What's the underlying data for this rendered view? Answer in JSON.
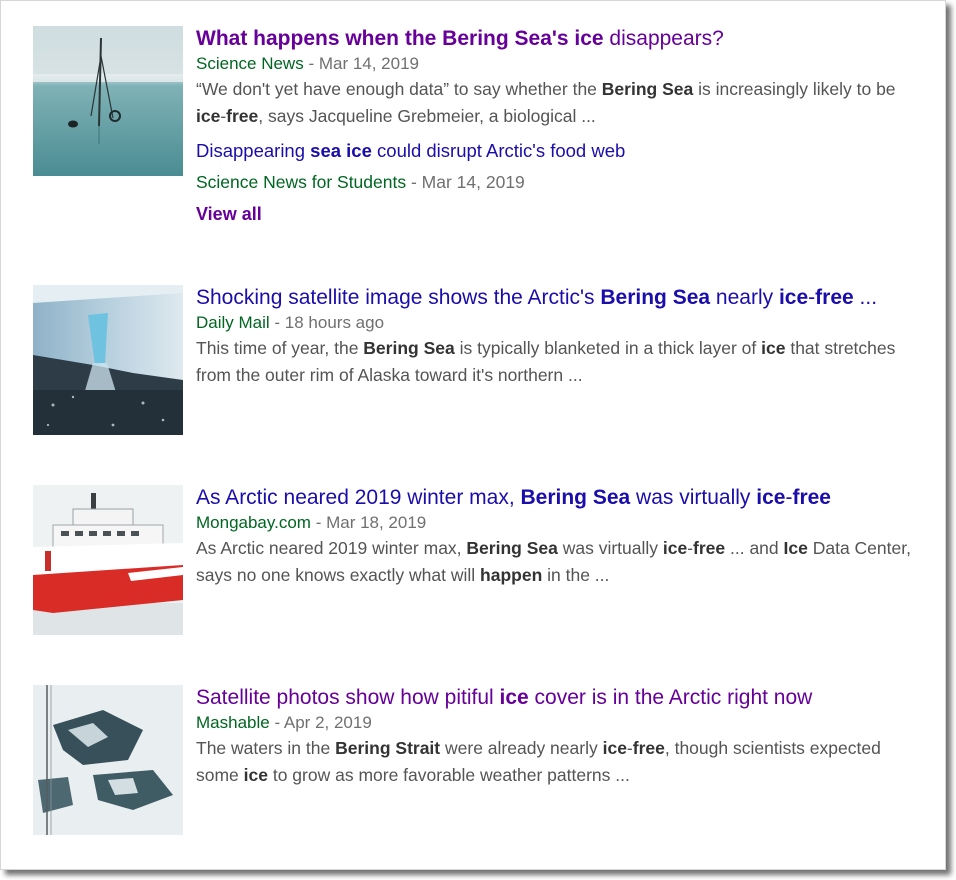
{
  "results": [
    {
      "title_parts": [
        "What happens when the Bering Sea's ice",
        " disappears?"
      ],
      "source": "Science News",
      "separator": " - ",
      "date": "Mar 14, 2019",
      "snippet_parts": [
        "“We don't yet have enough data” to say whether the ",
        "Bering Sea",
        " is increasingly likely to be ",
        "ice",
        "-",
        "free",
        ", says Jacqueline Grebmeier, a biological ..."
      ],
      "sub_result": {
        "title_parts": [
          "Disappearing ",
          "sea ice",
          " could disrupt Arctic's food web"
        ],
        "source": "Science News for Students",
        "separator": " - ",
        "date": "Mar 14, 2019"
      },
      "view_all": "View all",
      "thumbnail": "arctic-research-buoy-image"
    },
    {
      "title_parts": [
        "Shocking satellite image shows the Arctic's ",
        "Bering Sea",
        " nearly ",
        "ice",
        "-",
        "free",
        " ..."
      ],
      "source": "Daily Mail",
      "separator": " - ",
      "date": "18 hours ago",
      "snippet_parts": [
        "This time of year, the ",
        "Bering Sea",
        " is typically blanketed in a thick layer of ",
        "ice",
        " that stretches from the outer rim of Alaska toward it's northern ..."
      ],
      "thumbnail": "melting-ice-waterfall-image"
    },
    {
      "title_parts": [
        "As Arctic neared 2019 winter max, ",
        "Bering Sea",
        " was virtually ",
        "ice",
        "-",
        "free",
        ""
      ],
      "source": "Mongabay.com",
      "separator": " - ",
      "date": "Mar 18, 2019",
      "snippet_parts": [
        "As Arctic neared 2019 winter max, ",
        "Bering Sea",
        " was virtually ",
        "ice",
        "-",
        "free",
        " ... and ",
        "Ice",
        " Data Center, says no one knows exactly what will ",
        "happen",
        " in the ..."
      ],
      "thumbnail": "icebreaker-ship-image"
    },
    {
      "title_parts": [
        "Satellite photos show how pitiful ",
        "ice",
        " cover is in the Arctic right now"
      ],
      "source": "Mashable",
      "separator": " - ",
      "date": "Apr 2, 2019",
      "snippet_parts": [
        "The waters in the ",
        "Bering Strait",
        " were already nearly ",
        "ice",
        "-",
        "free",
        ", though scientists expected some ",
        "ice",
        " to grow as more favorable weather patterns ..."
      ],
      "thumbnail": "sea-ice-aerial-image"
    }
  ],
  "colors": {
    "link": "#1a0dab",
    "visited": "#660099",
    "source": "#006621",
    "snippet": "#545454",
    "meta": "#707070"
  }
}
